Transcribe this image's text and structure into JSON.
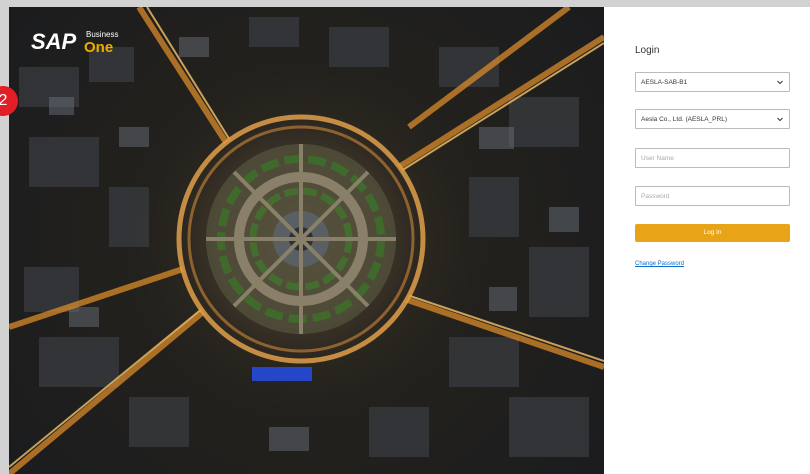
{
  "brand": {
    "logo_main": "SAP",
    "logo_sub_small": "Business",
    "logo_sub_big": "One"
  },
  "overlay": {
    "step_number": "2"
  },
  "login": {
    "title": "Login",
    "server_select": {
      "value": "AESLA-SAB-B1"
    },
    "company_select": {
      "value": "Aesla Co., Ltd. (AESLA_PRL)"
    },
    "username": {
      "placeholder": "User Name",
      "value": ""
    },
    "password": {
      "placeholder": "Password",
      "value": ""
    },
    "login_button": "Log In",
    "change_password_link": "Change Password"
  },
  "colors": {
    "accent_button": "#e8a317",
    "link": "#0a6ed1",
    "badge": "#e21f26"
  },
  "icons": [
    "chevron-down-icon"
  ]
}
